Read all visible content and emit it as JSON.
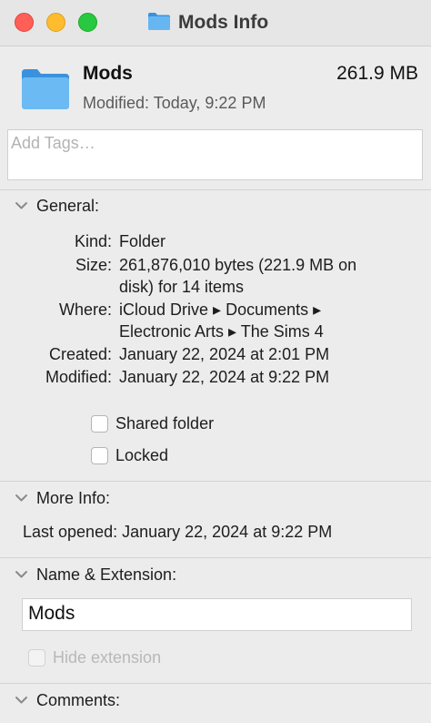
{
  "window": {
    "title": "Mods Info"
  },
  "header": {
    "name": "Mods",
    "size": "261.9 MB",
    "modified": "Modified: Today, 9:22 PM"
  },
  "tags": {
    "placeholder": "Add Tags…"
  },
  "general": {
    "label": "General:",
    "rows": [
      {
        "key": "Kind:",
        "lines": [
          "Folder"
        ]
      },
      {
        "key": "Size:",
        "lines": [
          "261,876,010 bytes (221.9 MB on",
          "disk) for 14 items"
        ]
      },
      {
        "key": "Where:",
        "lines": [
          "iCloud Drive ▸ Documents ▸",
          "Electronic Arts ▸ The Sims 4"
        ]
      },
      {
        "key": "Created:",
        "lines": [
          "January 22, 2024 at 2:01 PM"
        ]
      },
      {
        "key": "Modified:",
        "lines": [
          "January 22, 2024 at 9:22 PM"
        ]
      }
    ],
    "shared_folder": {
      "label": "Shared folder",
      "checked": false
    },
    "locked": {
      "label": "Locked",
      "checked": false
    }
  },
  "more_info": {
    "label": "More Info:",
    "last_opened": "Last opened: January 22, 2024 at 9:22 PM"
  },
  "name_extension": {
    "label": "Name & Extension:",
    "value": "Mods",
    "hide_extension": {
      "label": "Hide extension",
      "checked": false,
      "enabled": false
    }
  },
  "comments": {
    "label": "Comments:"
  },
  "colors": {
    "folder": "#5aaef0",
    "close": "#ff5f57",
    "minimize": "#febc2e",
    "zoom": "#28c840"
  }
}
